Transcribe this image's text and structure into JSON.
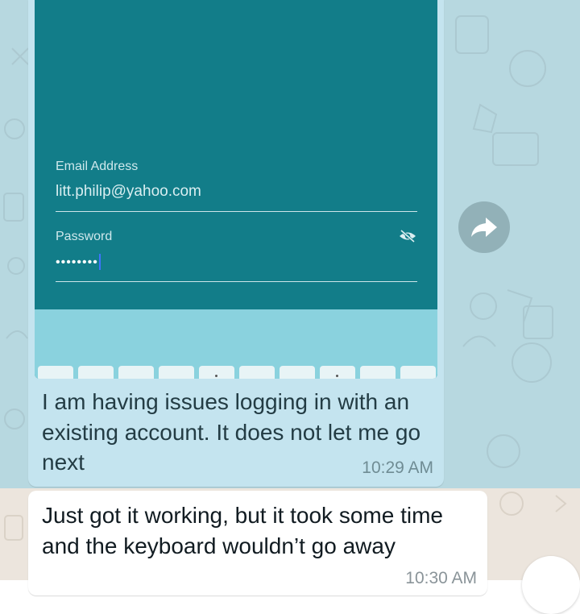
{
  "chat": {
    "outgoing_message": {
      "text": "I am having issues logging in with an existing account. It does not let me go next",
      "time": "10:29 AM",
      "screenshot": {
        "email_label": "Email Address",
        "email_value": "litt.philip@yahoo.com",
        "password_label": "Password",
        "password_value": "••••••••"
      }
    },
    "incoming_message": {
      "text": "Just got it working, but it took some time and the keyboard wouldn’t go away",
      "time": "10:30 AM"
    }
  },
  "icons": {
    "forward": "share-arrow-icon",
    "password_visibility": "eye-slash-icon"
  },
  "colors": {
    "selection_tint": "#b7d8e0",
    "outgoing_bubble": "#c4e4ef",
    "screenshot_teal": "#127d89",
    "incoming_bubble": "#ffffff",
    "chat_background": "#ece5dd"
  }
}
